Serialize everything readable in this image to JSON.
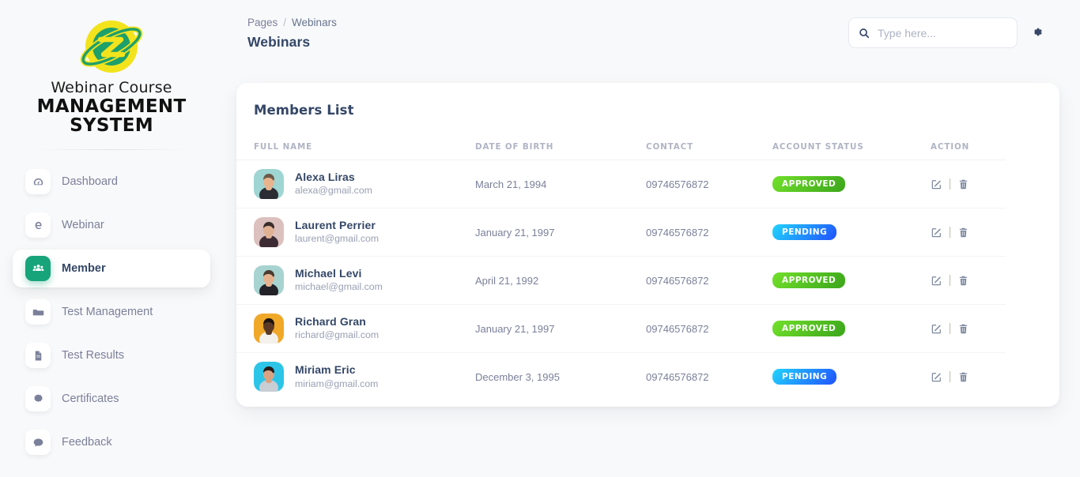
{
  "brand": {
    "line1": "Webinar Course",
    "line2": "MANAGEMENT SYSTEM",
    "logo_icon": "planet-globe-icon",
    "logo_outer_color": "#f2e31c",
    "logo_inner_color": "#1ea06b"
  },
  "sidebar": {
    "items": [
      {
        "label": "Dashboard",
        "icon": "gauge-icon",
        "active": false
      },
      {
        "label": "Webinar",
        "icon": "webinar-e-icon",
        "active": false
      },
      {
        "label": "Member",
        "icon": "users-icon",
        "active": true
      },
      {
        "label": "Test Management",
        "icon": "folder-icon",
        "active": false
      },
      {
        "label": "Test Results",
        "icon": "document-icon",
        "active": false
      },
      {
        "label": "Certificates",
        "icon": "badge-icon",
        "active": false
      },
      {
        "label": "Feedback",
        "icon": "chat-icon",
        "active": false
      }
    ],
    "active_color": "#17a47a"
  },
  "header": {
    "breadcrumb_root": "Pages",
    "breadcrumb_sep": "/",
    "breadcrumb_current": "Webinars",
    "page_title": "Webinars",
    "search_placeholder": "Type here...",
    "search_value": "",
    "search_icon": "search-icon",
    "settings_icon": "gear-icon"
  },
  "main": {
    "card_title": "Members List",
    "columns": [
      "FULL NAME",
      "DATE OF BIRTH",
      "CONTACT",
      "ACCOUNT STATUS",
      "ACTION"
    ],
    "rows": [
      {
        "name": "Alexa Liras",
        "email": "alexa@gmail.com",
        "dob": "March 21, 1994",
        "contact": "09746576872",
        "status": "APPROVED",
        "status_type": "approved",
        "avatar_bg": "#9fd5d2",
        "avatar_skin": "#e8b48e",
        "avatar_hair": "#6b5a4a",
        "avatar_shirt": "#2c2c34"
      },
      {
        "name": "Laurent Perrier",
        "email": "laurent@gmail.com",
        "dob": "January 21, 1997",
        "contact": "09746576872",
        "status": "PENDING",
        "status_type": "pending",
        "avatar_bg": "#dcc0bd",
        "avatar_skin": "#e0b193",
        "avatar_hair": "#3a2e2a",
        "avatar_shirt": "#3d2b33"
      },
      {
        "name": "Michael Levi",
        "email": "michael@gmail.com",
        "dob": "April 21, 1992",
        "contact": "09746576872",
        "status": "APPROVED",
        "status_type": "approved",
        "avatar_bg": "#a7d3d0",
        "avatar_skin": "#e6b391",
        "avatar_hair": "#4a3b30",
        "avatar_shirt": "#222228"
      },
      {
        "name": "Richard Gran",
        "email": "richard@gmail.com",
        "dob": "January 21, 1997",
        "contact": "09746576872",
        "status": "APPROVED",
        "status_type": "approved",
        "avatar_bg": "#f0a828",
        "avatar_skin": "#5a3a26",
        "avatar_hair": "#1d1410",
        "avatar_shirt": "#f4f1ec"
      },
      {
        "name": "Miriam Eric",
        "email": "miriam@gmail.com",
        "dob": "December 3, 1995",
        "contact": "09746576872",
        "status": "PENDING",
        "status_type": "pending",
        "avatar_bg": "#2cc5e8",
        "avatar_skin": "#d8a383",
        "avatar_hair": "#241a16",
        "avatar_shirt": "#c9cdd4"
      }
    ],
    "action_icons": [
      "edit-icon",
      "delete-icon"
    ],
    "badge_colors": {
      "approved": "#5fce22",
      "pending": "#21a8fd"
    }
  }
}
